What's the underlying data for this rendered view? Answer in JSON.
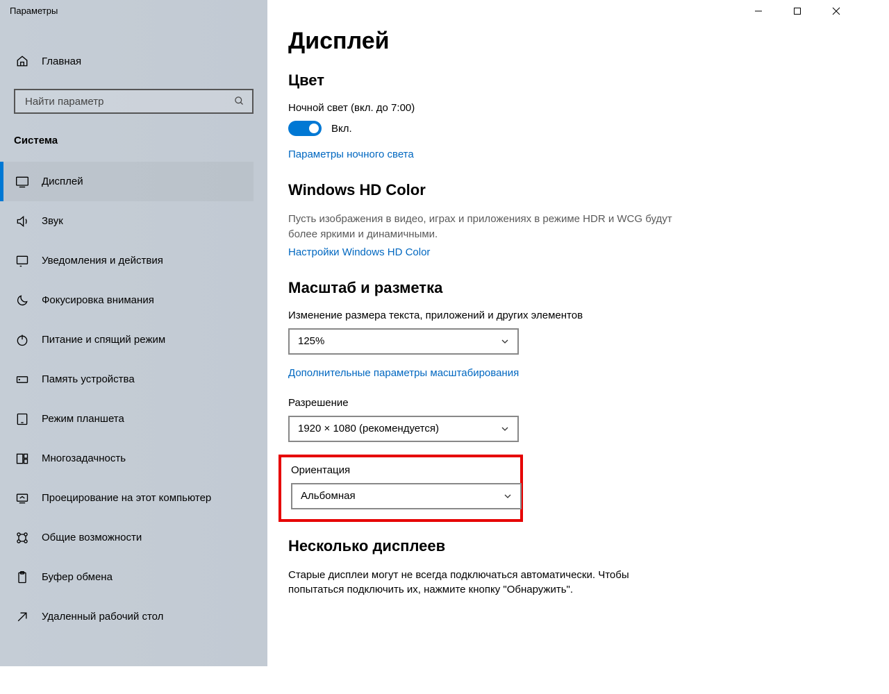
{
  "window_title": "Параметры",
  "sidebar": {
    "home_label": "Главная",
    "search_placeholder": "Найти параметр",
    "section_label": "Система",
    "items": [
      {
        "label": "Дисплей"
      },
      {
        "label": "Звук"
      },
      {
        "label": "Уведомления и действия"
      },
      {
        "label": "Фокусировка внимания"
      },
      {
        "label": "Питание и спящий режим"
      },
      {
        "label": "Память устройства"
      },
      {
        "label": "Режим планшета"
      },
      {
        "label": "Многозадачность"
      },
      {
        "label": "Проецирование на этот компьютер"
      },
      {
        "label": "Общие возможности"
      },
      {
        "label": "Буфер обмена"
      },
      {
        "label": "Удаленный рабочий стол"
      }
    ]
  },
  "main": {
    "title": "Дисплей",
    "color_heading": "Цвет",
    "nightlight_label": "Ночной свет (вкл. до 7:00)",
    "toggle_on_label": "Вкл.",
    "nightlight_link": "Параметры ночного света",
    "hdr_heading": "Windows HD Color",
    "hdr_desc": "Пусть изображения в видео, играх и приложениях в режиме HDR и WCG будут более яркими и динамичными.",
    "hdr_link": "Настройки Windows HD Color",
    "scale_heading": "Масштаб и разметка",
    "scale_label": "Изменение размера текста, приложений и других элементов",
    "scale_value": "125%",
    "scale_link": "Дополнительные параметры масштабирования",
    "resolution_label": "Разрешение",
    "resolution_value": "1920 × 1080 (рекомендуется)",
    "orientation_label": "Ориентация",
    "orientation_value": "Альбомная",
    "multi_heading": "Несколько дисплеев",
    "multi_desc": "Старые дисплеи могут не всегда подключаться автоматически. Чтобы попытаться подключить их, нажмите кнопку \"Обнаружить\"."
  }
}
